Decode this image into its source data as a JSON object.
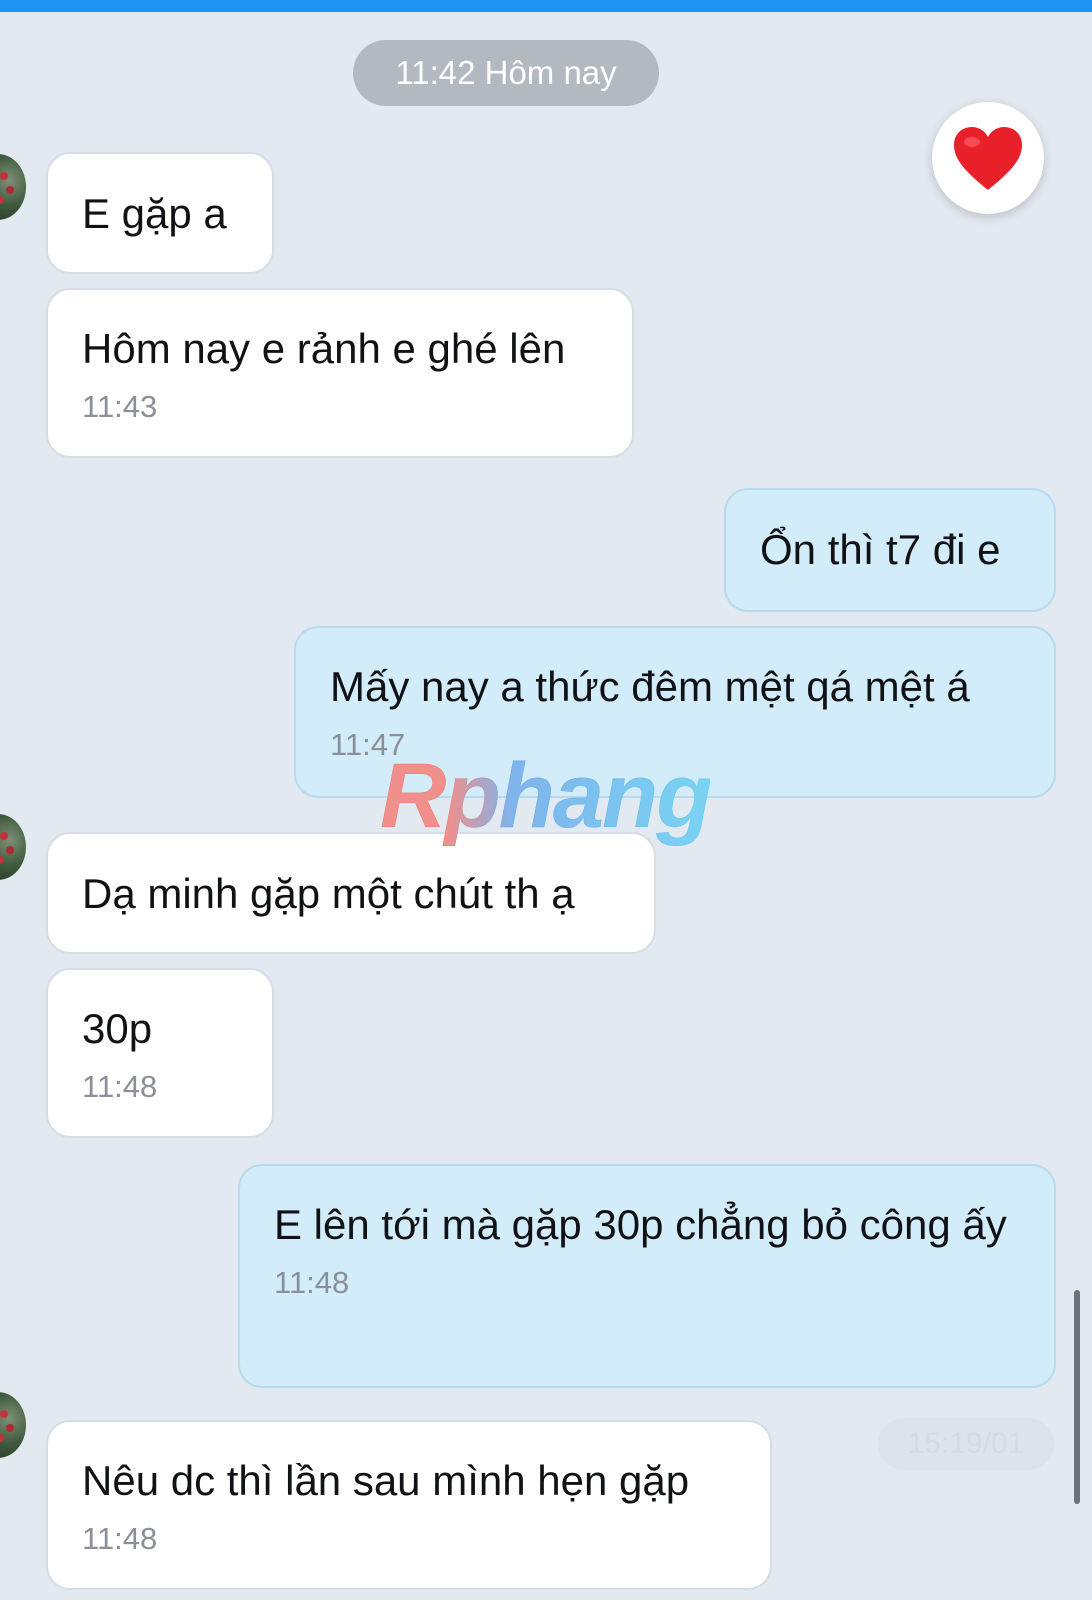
{
  "header": {
    "date_label": "11:42 Hôm nay"
  },
  "reaction": {
    "icon": "heart-icon",
    "color": "#e8202a"
  },
  "messages": [
    {
      "side": "received",
      "text": "E gặp a",
      "time": ""
    },
    {
      "side": "received",
      "text": "Hôm nay e rảnh e ghé lên",
      "time": "11:43"
    },
    {
      "side": "sent",
      "text": "Ổn thì t7 đi e",
      "time": ""
    },
    {
      "side": "sent",
      "text": "Mấy nay a thức đêm mệt qá mệt á",
      "time": "11:47"
    },
    {
      "side": "received",
      "text": "Dạ minh gặp một chút th ạ",
      "time": ""
    },
    {
      "side": "received",
      "text": "30p",
      "time": "11:48"
    },
    {
      "side": "sent",
      "text": "E lên tới mà gặp 30p chẳng bỏ công ấy",
      "time": "11:48"
    },
    {
      "side": "received",
      "text": "Nêu dc thì lần sau mình hẹn gặp",
      "time": "11:48"
    }
  ],
  "watermark": "Rphang",
  "scroll_date": "15:19/01"
}
